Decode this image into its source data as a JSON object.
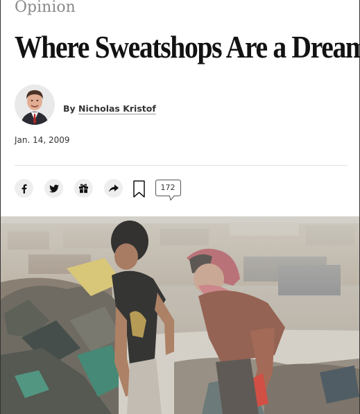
{
  "article": {
    "kicker": "Opinion",
    "headline": "Where Sweatshops Are a Dream",
    "byline_prefix": "By",
    "author": "Nicholas Kristof",
    "date": "Jan. 14, 2009"
  },
  "share_bar": {
    "buttons": [
      {
        "name": "facebook",
        "icon": "facebook-icon"
      },
      {
        "name": "twitter",
        "icon": "twitter-icon"
      },
      {
        "name": "gift",
        "icon": "gift-icon"
      },
      {
        "name": "share",
        "icon": "share-arrow-icon"
      }
    ],
    "bookmark_icon": "bookmark-icon",
    "comment_count": "172"
  },
  "colors": {
    "kicker": "#8a8a8a",
    "headline": "#121212",
    "share_button_bg": "#eeeeee"
  }
}
